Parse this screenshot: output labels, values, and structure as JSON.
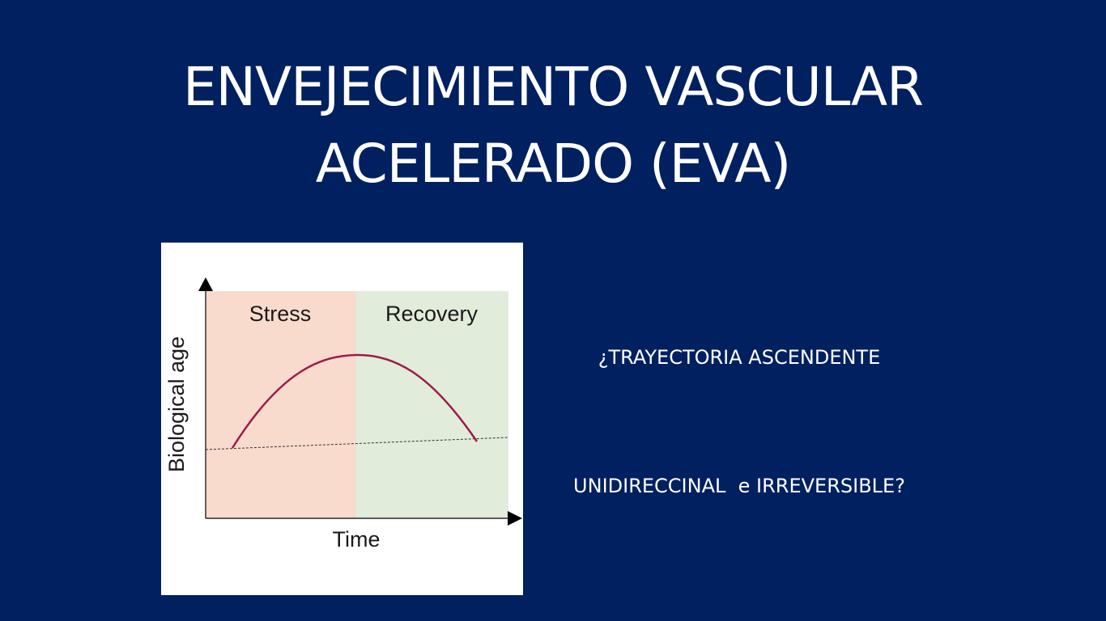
{
  "slide": {
    "background_color": "#002060",
    "title_lines": [
      "ENVEJECIMIENTO VASCULAR",
      "ACELERADO (EVA)"
    ],
    "question_lines": [
      "¿TRAYECTORIA ASCENDENTE",
      "UNIDIRECCINAL  e IRREVERSIBLE?"
    ]
  },
  "figure": {
    "stress_label": "Stress",
    "recovery_label": "Recovery",
    "y_axis_label": "Biological age",
    "x_axis_label": "Time",
    "stress_color": "#f9dbce",
    "recovery_color": "#e1ecda",
    "curve_color": "#9b1b4b"
  }
}
